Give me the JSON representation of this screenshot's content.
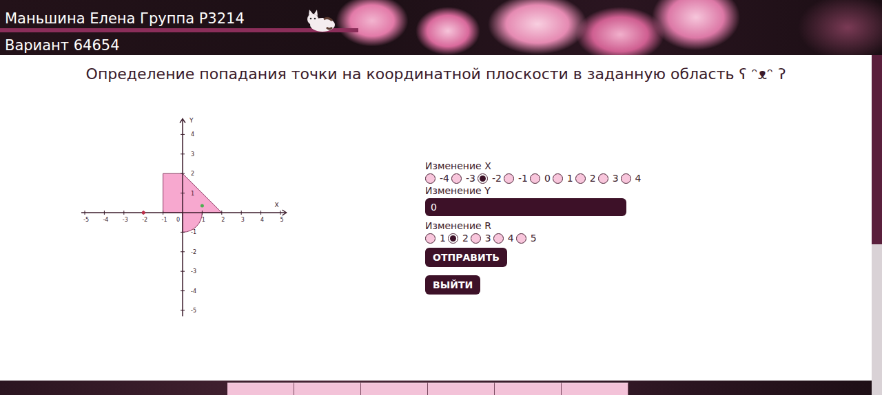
{
  "header": {
    "name": "Маньшина Елена Группа P3214",
    "variant": "Вариант 64654"
  },
  "title": "Определение попадания точки на координатной плоскости в заданную область ʕ ᵔᴥᵔ ʔ",
  "graph": {
    "x_label": "X",
    "y_label": "Y",
    "origin_label": "0",
    "x_ticks": [
      "-5",
      "-4",
      "-3",
      "-2",
      "-1",
      "1",
      "2",
      "3",
      "4",
      "5"
    ],
    "y_ticks": [
      "4",
      "3",
      "2",
      "1",
      "-1",
      "-2",
      "-3",
      "-4",
      "-5"
    ],
    "r": 2,
    "points": [
      {
        "x": 1,
        "y": 0.35,
        "color": "#4caf50"
      },
      {
        "x": -2,
        "y": 0,
        "color": "#c0304a"
      }
    ]
  },
  "form": {
    "x_label": "Изменение X",
    "x_options": [
      {
        "label": "-4",
        "selected": false
      },
      {
        "label": "-3",
        "selected": false
      },
      {
        "label": "-2",
        "selected": true
      },
      {
        "label": "-1",
        "selected": false
      },
      {
        "label": "0",
        "selected": false
      },
      {
        "label": "1",
        "selected": false
      },
      {
        "label": "2",
        "selected": false
      },
      {
        "label": "3",
        "selected": false
      },
      {
        "label": "4",
        "selected": false
      }
    ],
    "y_label": "Изменение Y",
    "y_value": "0",
    "r_label": "Изменение R",
    "r_options": [
      {
        "label": "1",
        "selected": false
      },
      {
        "label": "2",
        "selected": true
      },
      {
        "label": "3",
        "selected": false
      },
      {
        "label": "4",
        "selected": false
      },
      {
        "label": "5",
        "selected": false
      }
    ],
    "buttons": [
      "ОТПРАВИТЬ",
      "ВЫЙТИ"
    ]
  }
}
